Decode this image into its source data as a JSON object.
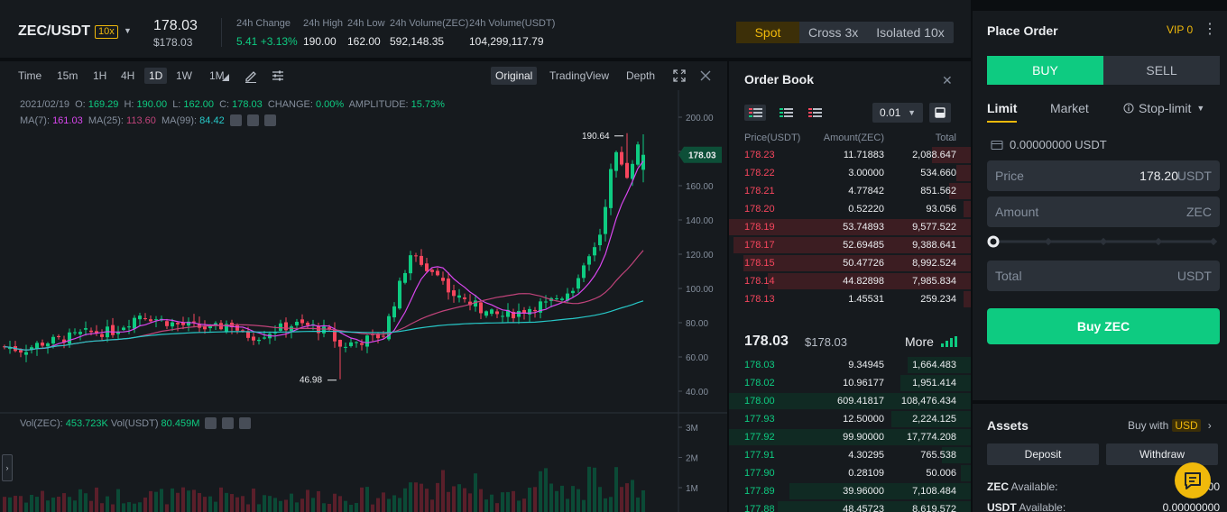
{
  "header": {
    "pair": "ZEC/USDT",
    "leverage_badge": "10x",
    "last_price": "178.03",
    "last_price_usd": "$178.03",
    "stats": [
      {
        "label": "24h Change",
        "value": "5.41 +3.13%",
        "trend": "up"
      },
      {
        "label": "24h High",
        "value": "190.00"
      },
      {
        "label": "24h Low",
        "value": "162.00"
      },
      {
        "label": "24h Volume(ZEC)",
        "value": "592,148.35"
      },
      {
        "label": "24h Volume(USDT)",
        "value": "104,299,117.79"
      }
    ],
    "modes": [
      {
        "label": "Spot",
        "active": true
      },
      {
        "label": "Cross 3x",
        "active": false
      },
      {
        "label": "Isolated 10x",
        "active": false
      }
    ]
  },
  "chart": {
    "intervals": [
      {
        "label": "Time",
        "active": false
      },
      {
        "label": "15m",
        "active": false
      },
      {
        "label": "1H",
        "active": false
      },
      {
        "label": "4H",
        "active": false
      },
      {
        "label": "1D",
        "active": true
      },
      {
        "label": "1W",
        "active": false
      },
      {
        "label": "1M",
        "active": false
      }
    ],
    "view_tabs": [
      {
        "label": "Original",
        "active": true
      },
      {
        "label": "TradingView",
        "active": false
      },
      {
        "label": "Depth",
        "active": false
      }
    ],
    "ohlc": {
      "date": "2021/02/19",
      "o_label": "O:",
      "o": "169.29",
      "h_label": "H:",
      "h": "190.00",
      "l_label": "L:",
      "l": "162.00",
      "c_label": "C:",
      "c": "178.03",
      "change_label": "CHANGE:",
      "change": "0.00%",
      "amplitude_label": "AMPLITUDE:",
      "amplitude": "15.73%"
    },
    "ma": {
      "ma7_label": "MA(7):",
      "ma7": "161.03",
      "ma25_label": "MA(25):",
      "ma25": "113.60",
      "ma99_label": "MA(99):",
      "ma99": "84.42"
    },
    "vol": {
      "zec_label": "Vol(ZEC):",
      "zec": "453.723K",
      "usdt_label": "Vol(USDT)",
      "usdt": "80.459M"
    },
    "price_axis": [
      "200.00",
      "180.00",
      "160.00",
      "140.00",
      "120.00",
      "100.00",
      "80.00",
      "60.00",
      "40.00"
    ],
    "vol_axis": [
      "3M",
      "2M",
      "1M"
    ],
    "current_price_tag": "178.03",
    "high_marker": "190.64",
    "low_marker": "46.98",
    "colors": {
      "up": "#0ecb81",
      "down": "#f6465d",
      "ma7": "#d946ef",
      "ma25": "#c0437a",
      "ma99": "#27c8c8"
    }
  },
  "order_book": {
    "title": "Order Book",
    "step": "0.01",
    "headers": {
      "price": "Price(USDT)",
      "amount": "Amount(ZEC)",
      "total": "Total"
    },
    "asks": [
      {
        "price": "178.23",
        "amount": "11.71883",
        "total": "2,088.647",
        "depth": 0.16
      },
      {
        "price": "178.22",
        "amount": "3.00000",
        "total": "534.660",
        "depth": 0.06
      },
      {
        "price": "178.21",
        "amount": "4.77842",
        "total": "851.562",
        "depth": 0.09
      },
      {
        "price": "178.20",
        "amount": "0.52220",
        "total": "93.056",
        "depth": 0.03
      },
      {
        "price": "178.19",
        "amount": "53.74893",
        "total": "9,577.522",
        "depth": 1.0
      },
      {
        "price": "178.17",
        "amount": "52.69485",
        "total": "9,388.641",
        "depth": 0.98
      },
      {
        "price": "178.15",
        "amount": "50.47726",
        "total": "8,992.524",
        "depth": 0.94
      },
      {
        "price": "178.14",
        "amount": "44.82898",
        "total": "7,985.834",
        "depth": 0.84
      },
      {
        "price": "178.13",
        "amount": "1.45531",
        "total": "259.234",
        "depth": 0.03
      }
    ],
    "last_price": "178.03",
    "last_price_usd": "$178.03",
    "more_label": "More",
    "bids": [
      {
        "price": "178.03",
        "amount": "9.34945",
        "total": "1,664.483",
        "depth": 0.26
      },
      {
        "price": "178.02",
        "amount": "10.96177",
        "total": "1,951.414",
        "depth": 0.29
      },
      {
        "price": "178.00",
        "amount": "609.41817",
        "total": "108,476.434",
        "depth": 1.0
      },
      {
        "price": "177.93",
        "amount": "12.50000",
        "total": "2,224.125",
        "depth": 0.33
      },
      {
        "price": "177.92",
        "amount": "99.90000",
        "total": "17,774.208",
        "depth": 1.0
      },
      {
        "price": "177.91",
        "amount": "4.30295",
        "total": "765.538",
        "depth": 0.12
      },
      {
        "price": "177.90",
        "amount": "0.28109",
        "total": "50.006",
        "depth": 0.04
      },
      {
        "price": "177.89",
        "amount": "39.96000",
        "total": "7,108.484",
        "depth": 0.75
      },
      {
        "price": "177.88",
        "amount": "48.45723",
        "total": "8,619.572",
        "depth": 0.8
      }
    ]
  },
  "place_order": {
    "title": "Place Order",
    "vip": "VIP 0",
    "buy_tab": "BUY",
    "sell_tab": "SELL",
    "order_types": {
      "limit": "Limit",
      "market": "Market",
      "stop_limit": "Stop-limit"
    },
    "available": "0.00000000 USDT",
    "price_label": "Price",
    "price_value": "178.20",
    "price_unit": "USDT",
    "amount_label": "Amount",
    "amount_unit": "ZEC",
    "total_label": "Total",
    "total_unit": "USDT",
    "slider_value": 0,
    "submit_label": "Buy ZEC"
  },
  "assets": {
    "title": "Assets",
    "buy_with_label": "Buy with",
    "buy_with_currency": "USD",
    "deposit": "Deposit",
    "withdraw": "Withdraw",
    "zec_label": "ZEC",
    "zec_available_label": "Available:",
    "zec_value": "0.00",
    "usdt_label": "USDT",
    "usdt_available_label": "Available:",
    "usdt_value": "0.00000000"
  }
}
